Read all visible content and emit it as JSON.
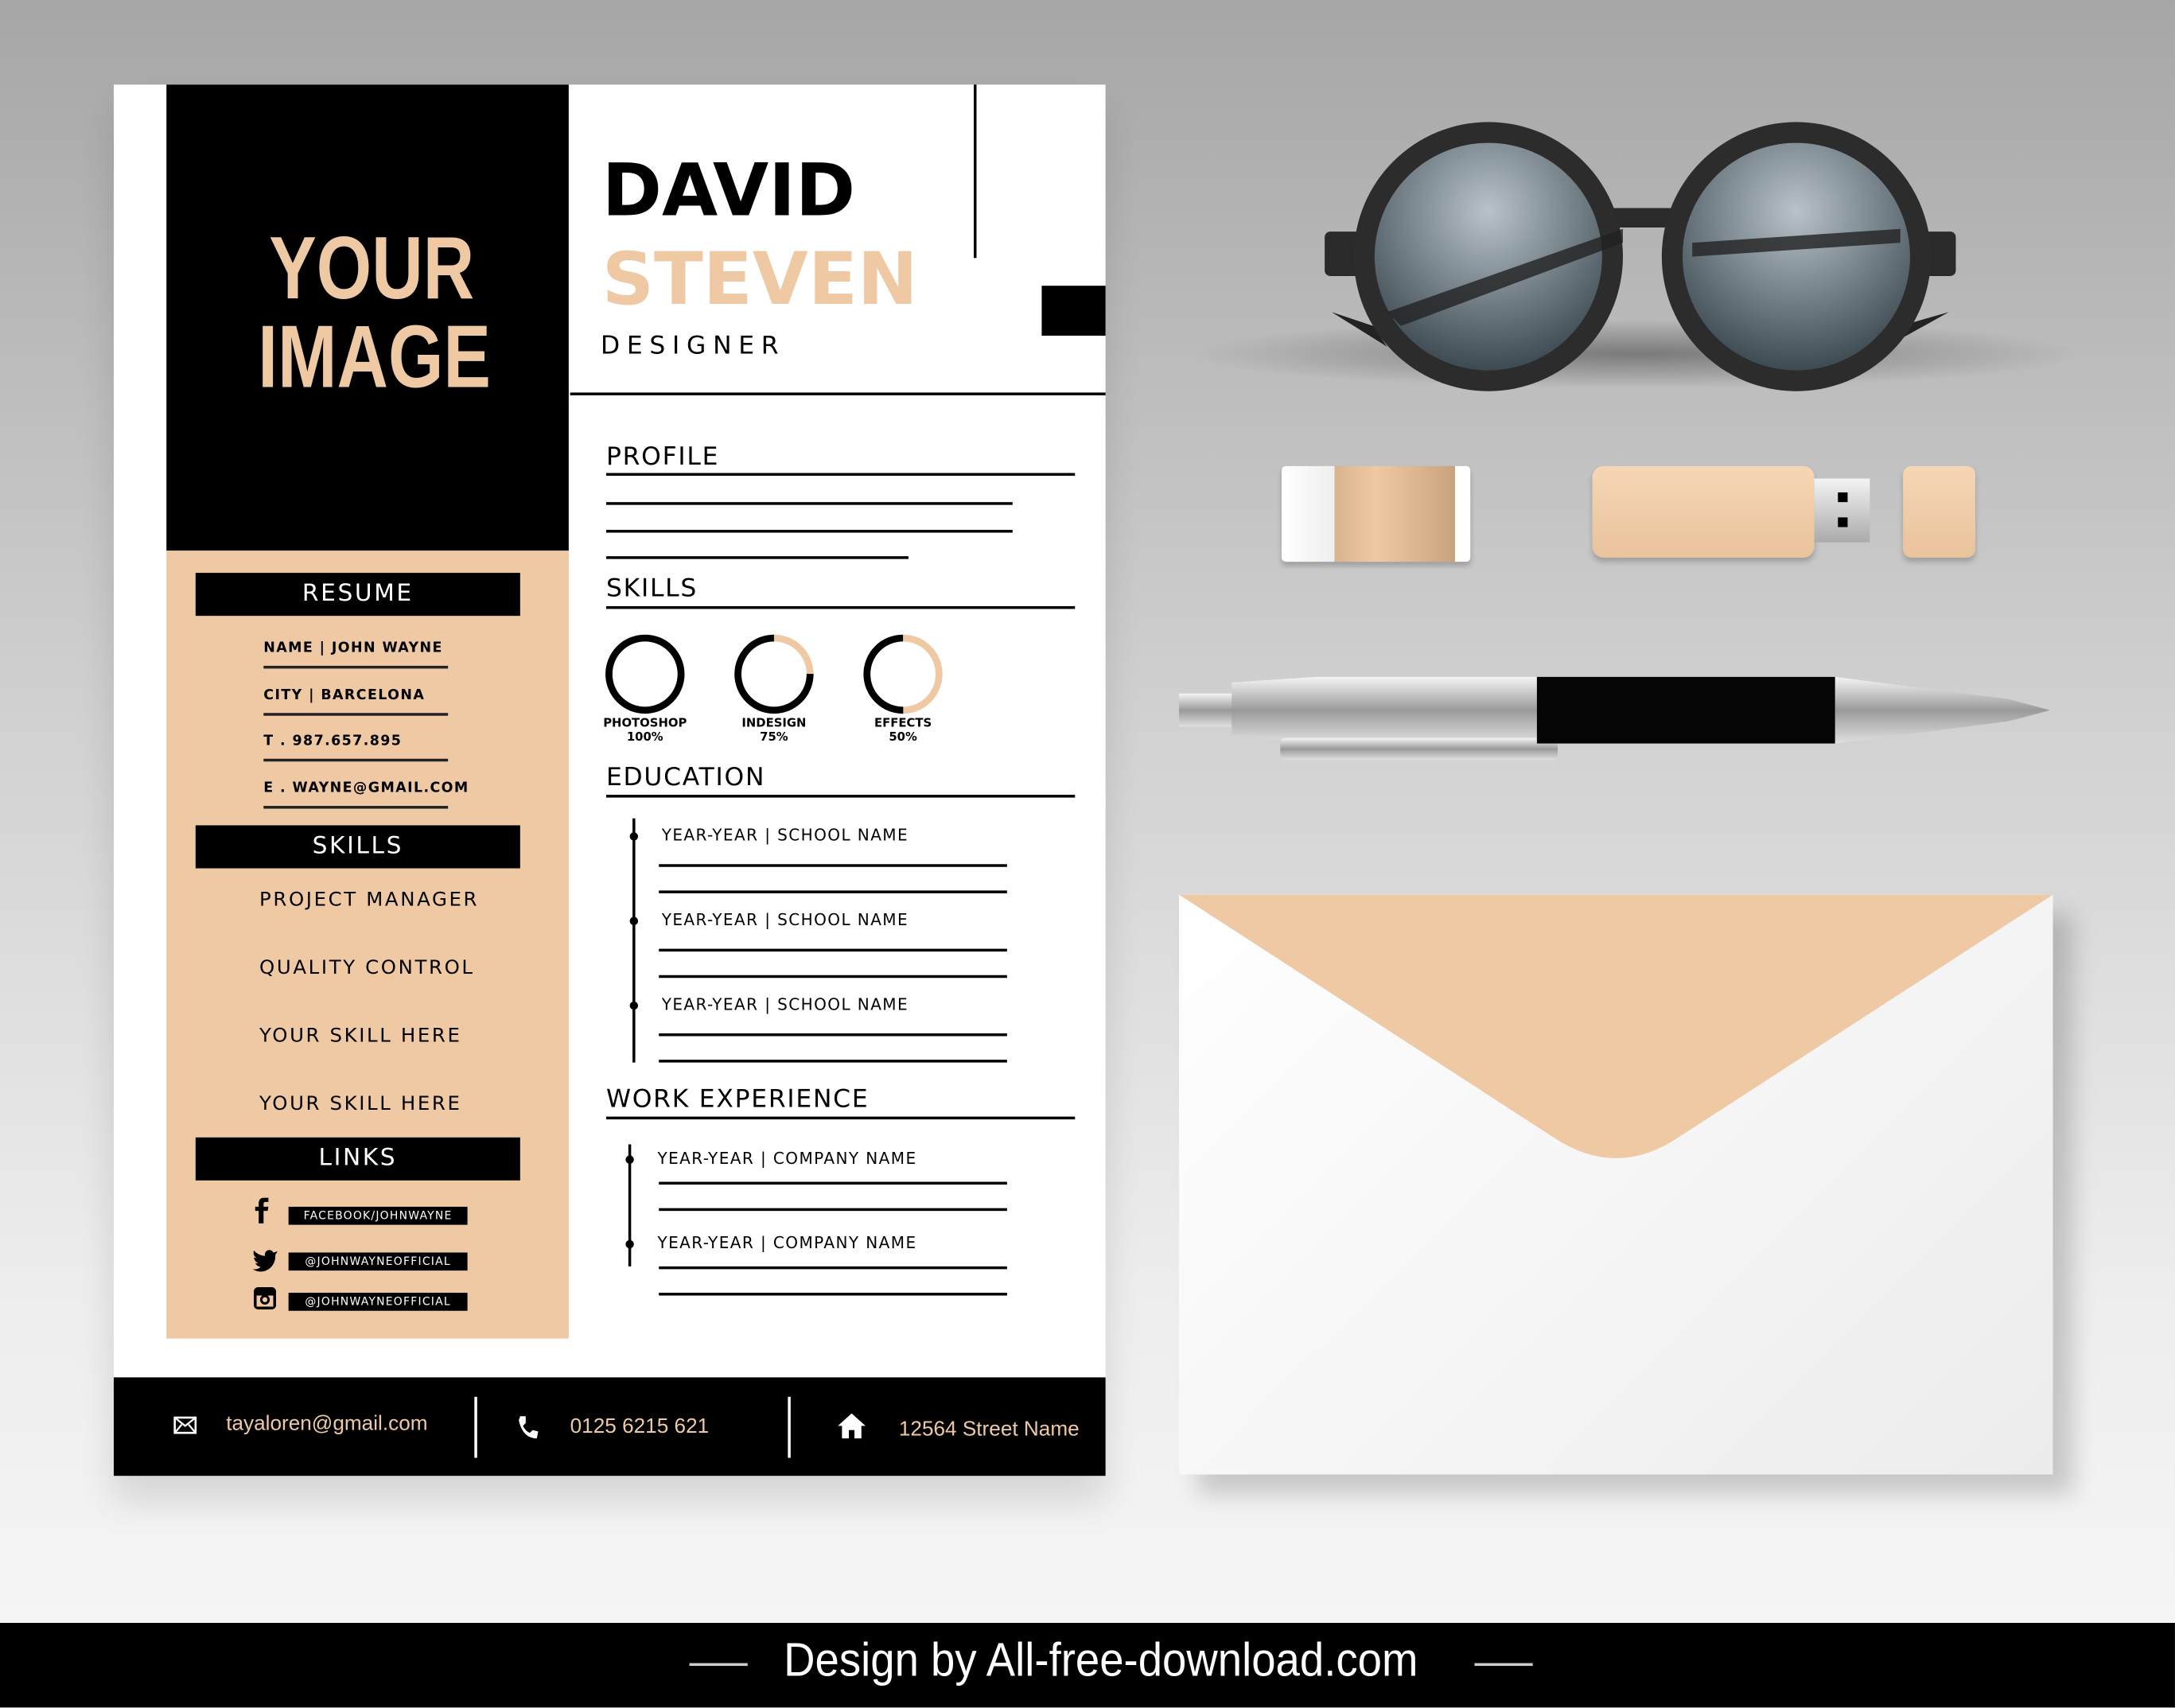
{
  "photo_placeholder": {
    "line1": "YOUR",
    "line2": "IMAGE"
  },
  "header": {
    "first_name": "DAVID",
    "last_name": "STEVEN",
    "title": "DESIGNER"
  },
  "sections": {
    "profile": "PROFILE",
    "skills": "SKILLS",
    "education": "EDUCATION",
    "work": "WORK EXPERIENCE"
  },
  "skill_rings": [
    {
      "name": "PHOTOSHOP",
      "percent_label": "100%",
      "value": 100
    },
    {
      "name": "INDESIGN",
      "percent_label": "75%",
      "value": 75
    },
    {
      "name": "EFFECTS",
      "percent_label": "50%",
      "value": 50
    }
  ],
  "education": [
    "YEAR-YEAR | SCHOOL NAME",
    "YEAR-YEAR | SCHOOL NAME",
    "YEAR-YEAR | SCHOOL NAME"
  ],
  "work": [
    "YEAR-YEAR | COMPANY NAME",
    "YEAR-YEAR | COMPANY NAME"
  ],
  "sidebar": {
    "resume_title": "RESUME",
    "info": [
      "NAME | JOHN WAYNE",
      "CITY | BARCELONA",
      "T . 987.657.895",
      "E . WAYNE@GMAIL.COM"
    ],
    "skills_title": "SKILLS",
    "skills": [
      "PROJECT MANAGER",
      "QUALITY CONTROL",
      "YOUR SKILL HERE",
      "YOUR SKILL HERE"
    ],
    "links_title": "LINKS",
    "links": [
      {
        "icon": "facebook-icon",
        "label": "FACEBOOK/JOHNWAYNE"
      },
      {
        "icon": "twitter-icon",
        "label": "@JOHNWAYNEOFFICIAL"
      },
      {
        "icon": "instagram-icon",
        "label": "@JOHNWAYNEOFFICIAL"
      }
    ]
  },
  "footer": {
    "email": "tayaloren@gmail.com",
    "phone": "0125 6215 621",
    "address": "12564 Street Name"
  },
  "watermark": "Design by All-free-download.com",
  "colors": {
    "accent": "#efc9a4",
    "dark": "#000000"
  }
}
